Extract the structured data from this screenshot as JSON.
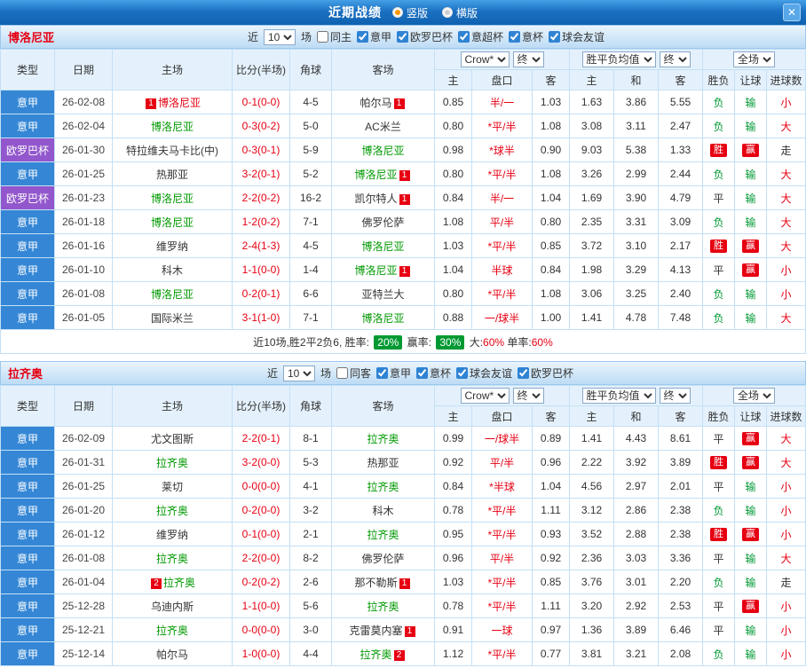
{
  "titlebar": {
    "title": "近期战绩",
    "close": "✕",
    "radios": [
      {
        "key": "vertical",
        "label": "竖版",
        "selected": true
      },
      {
        "key": "horizontal",
        "label": "横版",
        "selected": false
      }
    ]
  },
  "colors": {
    "titlebar_blue": "#1a70c2",
    "league_colors": {
      "意甲": "#3587d6",
      "欧罗巴杯": "#9257cc",
      "意杯": "#3587d6"
    },
    "win_red": "#e60012",
    "loss_green": "#009933",
    "focus_team_green": "#009900",
    "score_red": "#e60012",
    "footer_badge_green": "#009933"
  },
  "sections": [
    {
      "key": "bologna",
      "team": "博洛尼亚",
      "team_color": "#e60012",
      "filters": {
        "prefix": "近",
        "count": "10",
        "suffix": "场",
        "checkboxes": [
          {
            "label": "同主",
            "checked": false
          },
          {
            "label": "意甲",
            "checked": true
          },
          {
            "label": "欧罗巴杯",
            "checked": true
          },
          {
            "label": "意超杯",
            "checked": true
          },
          {
            "label": "意杯",
            "checked": true
          },
          {
            "label": "球会友谊",
            "checked": true
          }
        ]
      },
      "header": {
        "static_cols": [
          "类型",
          "日期",
          "主场",
          "比分(半场)",
          "角球",
          "客场"
        ],
        "odds_source": "Crow*",
        "odds_period": "终",
        "avg_source": "胜平负均值",
        "avg_period": "终",
        "scope": "全场",
        "odds_cols": [
          "主",
          "盘口",
          "客"
        ],
        "avg_cols": [
          "主",
          "和",
          "客"
        ],
        "result_cols": [
          "胜负",
          "让球",
          "进球数"
        ]
      },
      "rows": [
        {
          "type": "意甲",
          "date": "26-02-08",
          "home": "博洛尼亚",
          "home_color": "#e60012",
          "home_badge": "1",
          "score": "0-1(0-0)",
          "corner": "4-5",
          "away": "帕尔马",
          "away_color": "#333333",
          "away_badge": "1",
          "odds": [
            "0.85",
            "半/一",
            "1.03"
          ],
          "avg": [
            "1.63",
            "3.86",
            "5.55"
          ],
          "results": [
            {
              "t": "负",
              "s": "loss"
            },
            {
              "t": "输",
              "s": "loss"
            },
            {
              "t": "小",
              "s": "red"
            }
          ]
        },
        {
          "type": "意甲",
          "date": "26-02-04",
          "home": "博洛尼亚",
          "home_color": "#009900",
          "score": "0-3(0-2)",
          "corner": "5-0",
          "away": "AC米兰",
          "away_color": "#333333",
          "odds": [
            "0.80",
            "*平/半",
            "1.08"
          ],
          "avg": [
            "3.08",
            "3.11",
            "2.47"
          ],
          "results": [
            {
              "t": "负",
              "s": "loss"
            },
            {
              "t": "输",
              "s": "loss"
            },
            {
              "t": "大",
              "s": "red"
            }
          ]
        },
        {
          "type": "欧罗巴杯",
          "date": "26-01-30",
          "home": "特拉维夫马卡比(中)",
          "home_color": "#333333",
          "score": "0-3(0-1)",
          "corner": "5-9",
          "away": "博洛尼亚",
          "away_color": "#009900",
          "odds": [
            "0.98",
            "*球半",
            "0.90"
          ],
          "avg": [
            "9.03",
            "5.38",
            "1.33"
          ],
          "results": [
            {
              "t": "胜",
              "s": "win"
            },
            {
              "t": "赢",
              "s": "win"
            },
            {
              "t": "走",
              "s": "draw"
            }
          ]
        },
        {
          "type": "意甲",
          "date": "26-01-25",
          "home": "热那亚",
          "home_color": "#333333",
          "score": "3-2(0-1)",
          "corner": "5-2",
          "away": "博洛尼亚",
          "away_color": "#009900",
          "away_badge": "1",
          "odds": [
            "0.80",
            "*平/半",
            "1.08"
          ],
          "avg": [
            "3.26",
            "2.99",
            "2.44"
          ],
          "results": [
            {
              "t": "负",
              "s": "loss"
            },
            {
              "t": "输",
              "s": "loss"
            },
            {
              "t": "大",
              "s": "red"
            }
          ]
        },
        {
          "type": "欧罗巴杯",
          "date": "26-01-23",
          "home": "博洛尼亚",
          "home_color": "#009900",
          "score": "2-2(0-2)",
          "corner": "16-2",
          "away": "凯尔特人",
          "away_color": "#333333",
          "away_badge": "1",
          "odds": [
            "0.84",
            "半/一",
            "1.04"
          ],
          "avg": [
            "1.69",
            "3.90",
            "4.79"
          ],
          "results": [
            {
              "t": "平",
              "s": "draw"
            },
            {
              "t": "输",
              "s": "loss"
            },
            {
              "t": "大",
              "s": "red"
            }
          ]
        },
        {
          "type": "意甲",
          "date": "26-01-18",
          "home": "博洛尼亚",
          "home_color": "#009900",
          "score": "1-2(0-2)",
          "corner": "7-1",
          "away": "佛罗伦萨",
          "away_color": "#333333",
          "odds": [
            "1.08",
            "平/半",
            "0.80"
          ],
          "avg": [
            "2.35",
            "3.31",
            "3.09"
          ],
          "results": [
            {
              "t": "负",
              "s": "loss"
            },
            {
              "t": "输",
              "s": "loss"
            },
            {
              "t": "大",
              "s": "red"
            }
          ]
        },
        {
          "type": "意甲",
          "date": "26-01-16",
          "home": "维罗纳",
          "home_color": "#333333",
          "score": "2-4(1-3)",
          "corner": "4-5",
          "away": "博洛尼亚",
          "away_color": "#009900",
          "odds": [
            "1.03",
            "*平/半",
            "0.85"
          ],
          "avg": [
            "3.72",
            "3.10",
            "2.17"
          ],
          "results": [
            {
              "t": "胜",
              "s": "win"
            },
            {
              "t": "赢",
              "s": "win"
            },
            {
              "t": "大",
              "s": "red"
            }
          ]
        },
        {
          "type": "意甲",
          "date": "26-01-10",
          "home": "科木",
          "home_color": "#333333",
          "score": "1-1(0-0)",
          "corner": "1-4",
          "away": "博洛尼亚",
          "away_color": "#009900",
          "away_badge": "1",
          "odds": [
            "1.04",
            "半球",
            "0.84"
          ],
          "avg": [
            "1.98",
            "3.29",
            "4.13"
          ],
          "results": [
            {
              "t": "平",
              "s": "draw"
            },
            {
              "t": "赢",
              "s": "win"
            },
            {
              "t": "小",
              "s": "red"
            }
          ]
        },
        {
          "type": "意甲",
          "date": "26-01-08",
          "home": "博洛尼亚",
          "home_color": "#009900",
          "score": "0-2(0-1)",
          "corner": "6-6",
          "away": "亚特兰大",
          "away_color": "#333333",
          "odds": [
            "0.80",
            "*平/半",
            "1.08"
          ],
          "avg": [
            "3.06",
            "3.25",
            "2.40"
          ],
          "results": [
            {
              "t": "负",
              "s": "loss"
            },
            {
              "t": "输",
              "s": "loss"
            },
            {
              "t": "小",
              "s": "red"
            }
          ]
        },
        {
          "type": "意甲",
          "date": "26-01-05",
          "home": "国际米兰",
          "home_color": "#333333",
          "score": "3-1(1-0)",
          "corner": "7-1",
          "away": "博洛尼亚",
          "away_color": "#009900",
          "odds": [
            "0.88",
            "一/球半",
            "1.00"
          ],
          "avg": [
            "1.41",
            "4.78",
            "7.48"
          ],
          "results": [
            {
              "t": "负",
              "s": "loss"
            },
            {
              "t": "输",
              "s": "loss"
            },
            {
              "t": "大",
              "s": "red"
            }
          ]
        }
      ],
      "footer": [
        {
          "t": "近10场,胜2平2负6, 胜率: ",
          "s": "plain"
        },
        {
          "t": "20%",
          "s": "green-badge"
        },
        {
          "t": " 赢率: ",
          "s": "plain"
        },
        {
          "t": "30%",
          "s": "green-badge"
        },
        {
          "t": " 大:",
          "s": "plain"
        },
        {
          "t": "60%",
          "s": "red"
        },
        {
          "t": " 单率:",
          "s": "plain"
        },
        {
          "t": "60%",
          "s": "red"
        }
      ]
    },
    {
      "key": "lazio",
      "team": "拉齐奥",
      "team_color": "#e60012",
      "filters": {
        "prefix": "近",
        "count": "10",
        "suffix": "场",
        "checkboxes": [
          {
            "label": "同客",
            "checked": false
          },
          {
            "label": "意甲",
            "checked": true
          },
          {
            "label": "意杯",
            "checked": true
          },
          {
            "label": "球会友谊",
            "checked": true
          },
          {
            "label": "欧罗巴杯",
            "checked": true
          }
        ]
      },
      "header": {
        "static_cols": [
          "类型",
          "日期",
          "主场",
          "比分(半场)",
          "角球",
          "客场"
        ],
        "odds_source": "Crow*",
        "odds_period": "终",
        "avg_source": "胜平负均值",
        "avg_period": "终",
        "scope": "全场",
        "odds_cols": [
          "主",
          "盘口",
          "客"
        ],
        "avg_cols": [
          "主",
          "和",
          "客"
        ],
        "result_cols": [
          "胜负",
          "让球",
          "进球数"
        ]
      },
      "rows": [
        {
          "type": "意甲",
          "date": "26-02-09",
          "home": "尤文图斯",
          "home_color": "#333333",
          "score": "2-2(0-1)",
          "corner": "8-1",
          "away": "拉齐奥",
          "away_color": "#009900",
          "odds": [
            "0.99",
            "一/球半",
            "0.89"
          ],
          "avg": [
            "1.41",
            "4.43",
            "8.61"
          ],
          "results": [
            {
              "t": "平",
              "s": "draw"
            },
            {
              "t": "赢",
              "s": "win"
            },
            {
              "t": "大",
              "s": "red"
            }
          ]
        },
        {
          "type": "意甲",
          "date": "26-01-31",
          "home": "拉齐奥",
          "home_color": "#009900",
          "score": "3-2(0-0)",
          "corner": "5-3",
          "away": "热那亚",
          "away_color": "#333333",
          "odds": [
            "0.92",
            "平/半",
            "0.96"
          ],
          "avg": [
            "2.22",
            "3.92",
            "3.89"
          ],
          "results": [
            {
              "t": "胜",
              "s": "win"
            },
            {
              "t": "赢",
              "s": "win"
            },
            {
              "t": "大",
              "s": "red"
            }
          ]
        },
        {
          "type": "意甲",
          "date": "26-01-25",
          "home": "莱切",
          "home_color": "#333333",
          "score": "0-0(0-0)",
          "corner": "4-1",
          "away": "拉齐奥",
          "away_color": "#009900",
          "odds": [
            "0.84",
            "*半球",
            "1.04"
          ],
          "avg": [
            "4.56",
            "2.97",
            "2.01"
          ],
          "results": [
            {
              "t": "平",
              "s": "draw"
            },
            {
              "t": "输",
              "s": "loss"
            },
            {
              "t": "小",
              "s": "red"
            }
          ]
        },
        {
          "type": "意甲",
          "date": "26-01-20",
          "home": "拉齐奥",
          "home_color": "#009900",
          "score": "0-2(0-0)",
          "corner": "3-2",
          "away": "科木",
          "away_color": "#333333",
          "odds": [
            "0.78",
            "*平/半",
            "1.11"
          ],
          "avg": [
            "3.12",
            "2.86",
            "2.38"
          ],
          "results": [
            {
              "t": "负",
              "s": "loss"
            },
            {
              "t": "输",
              "s": "loss"
            },
            {
              "t": "小",
              "s": "red"
            }
          ]
        },
        {
          "type": "意甲",
          "date": "26-01-12",
          "home": "维罗纳",
          "home_color": "#333333",
          "score": "0-1(0-0)",
          "corner": "2-1",
          "away": "拉齐奥",
          "away_color": "#009900",
          "odds": [
            "0.95",
            "*平/半",
            "0.93"
          ],
          "avg": [
            "3.52",
            "2.88",
            "2.38"
          ],
          "results": [
            {
              "t": "胜",
              "s": "win"
            },
            {
              "t": "赢",
              "s": "win"
            },
            {
              "t": "小",
              "s": "red"
            }
          ]
        },
        {
          "type": "意甲",
          "date": "26-01-08",
          "home": "拉齐奥",
          "home_color": "#009900",
          "score": "2-2(0-0)",
          "corner": "8-2",
          "away": "佛罗伦萨",
          "away_color": "#333333",
          "odds": [
            "0.96",
            "平/半",
            "0.92"
          ],
          "avg": [
            "2.36",
            "3.03",
            "3.36"
          ],
          "results": [
            {
              "t": "平",
              "s": "draw"
            },
            {
              "t": "输",
              "s": "loss"
            },
            {
              "t": "大",
              "s": "red"
            }
          ]
        },
        {
          "type": "意甲",
          "date": "26-01-04",
          "home": "拉齐奥",
          "home_color": "#009900",
          "home_badge": "2",
          "score": "0-2(0-2)",
          "corner": "2-6",
          "away": "那不勒斯",
          "away_color": "#333333",
          "away_badge": "1",
          "odds": [
            "1.03",
            "*平/半",
            "0.85"
          ],
          "avg": [
            "3.76",
            "3.01",
            "2.20"
          ],
          "results": [
            {
              "t": "负",
              "s": "loss"
            },
            {
              "t": "输",
              "s": "loss"
            },
            {
              "t": "走",
              "s": "draw"
            }
          ]
        },
        {
          "type": "意甲",
          "date": "25-12-28",
          "home": "乌迪内斯",
          "home_color": "#333333",
          "score": "1-1(0-0)",
          "corner": "5-6",
          "away": "拉齐奥",
          "away_color": "#009900",
          "odds": [
            "0.78",
            "*平/半",
            "1.11"
          ],
          "avg": [
            "3.20",
            "2.92",
            "2.53"
          ],
          "results": [
            {
              "t": "平",
              "s": "draw"
            },
            {
              "t": "赢",
              "s": "win"
            },
            {
              "t": "小",
              "s": "red"
            }
          ]
        },
        {
          "type": "意甲",
          "date": "25-12-21",
          "home": "拉齐奥",
          "home_color": "#009900",
          "score": "0-0(0-0)",
          "corner": "3-0",
          "away": "克雷莫内塞",
          "away_color": "#333333",
          "away_badge": "1",
          "odds": [
            "0.91",
            "一球",
            "0.97"
          ],
          "avg": [
            "1.36",
            "3.89",
            "6.46"
          ],
          "results": [
            {
              "t": "平",
              "s": "draw"
            },
            {
              "t": "输",
              "s": "loss"
            },
            {
              "t": "小",
              "s": "red"
            }
          ]
        },
        {
          "type": "意甲",
          "date": "25-12-14",
          "home": "帕尔马",
          "home_color": "#333333",
          "score": "1-0(0-0)",
          "corner": "4-4",
          "away": "拉齐奥",
          "away_color": "#009900",
          "away_badge": "2",
          "odds": [
            "1.12",
            "*平/半",
            "0.77"
          ],
          "avg": [
            "3.81",
            "3.21",
            "2.08"
          ],
          "results": [
            {
              "t": "负",
              "s": "loss"
            },
            {
              "t": "输",
              "s": "loss"
            },
            {
              "t": "小",
              "s": "red"
            }
          ]
        }
      ],
      "footer": []
    }
  ]
}
